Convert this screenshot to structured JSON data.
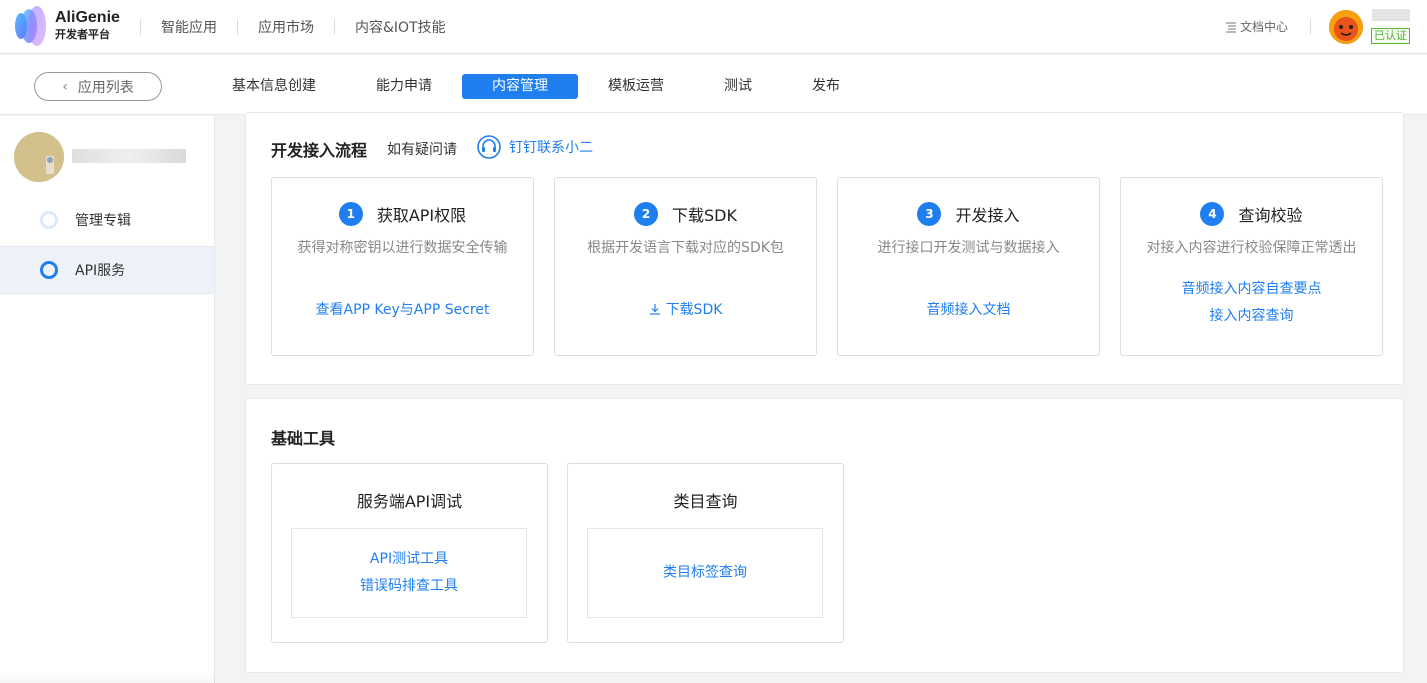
{
  "brand": {
    "name": "AliGenie",
    "subtitle": "开发者平台"
  },
  "top_nav": [
    {
      "label": "智能应用"
    },
    {
      "label": "应用市场"
    },
    {
      "label": "内容&IOT技能"
    }
  ],
  "doc_center": {
    "label": "文档中心",
    "icon": "list-icon"
  },
  "user": {
    "badge": "已认证"
  },
  "back_button": {
    "label": "应用列表"
  },
  "tabs": [
    {
      "label": "基本信息创建"
    },
    {
      "label": "能力申请"
    },
    {
      "label": "内容管理",
      "active": true
    },
    {
      "label": "模板运营"
    },
    {
      "label": "测试"
    },
    {
      "label": "发布"
    }
  ],
  "sidebar": {
    "items": [
      {
        "label": "管理专辑"
      },
      {
        "label": "API服务",
        "active": true
      }
    ]
  },
  "process": {
    "title": "开发接入流程",
    "hint": "如有疑问请",
    "contact": "钉钉联系小二",
    "steps": [
      {
        "num": "1",
        "title": "获取API权限",
        "desc": "获得对称密钥以进行数据安全传输",
        "links": [
          "查看APP Key与APP Secret"
        ]
      },
      {
        "num": "2",
        "title": "下载SDK",
        "desc": "根据开发语言下载对应的SDK包",
        "links": [
          "下载SDK"
        ]
      },
      {
        "num": "3",
        "title": "开发接入",
        "desc": "进行接口开发测试与数据接入",
        "links": [
          "音频接入文档"
        ]
      },
      {
        "num": "4",
        "title": "查询校验",
        "desc": "对接入内容进行校验保障正常透出",
        "links": [
          "音频接入内容自查要点",
          "接入内容查询"
        ]
      }
    ]
  },
  "tools": {
    "title": "基础工具",
    "cards": [
      {
        "title": "服务端API调试",
        "links": [
          "API测试工具",
          "错误码排查工具"
        ]
      },
      {
        "title": "类目查询",
        "links": [
          "类目标签查询"
        ]
      }
    ]
  },
  "colors": {
    "primary": "#1f7ff0",
    "verified": "#57b03a"
  }
}
